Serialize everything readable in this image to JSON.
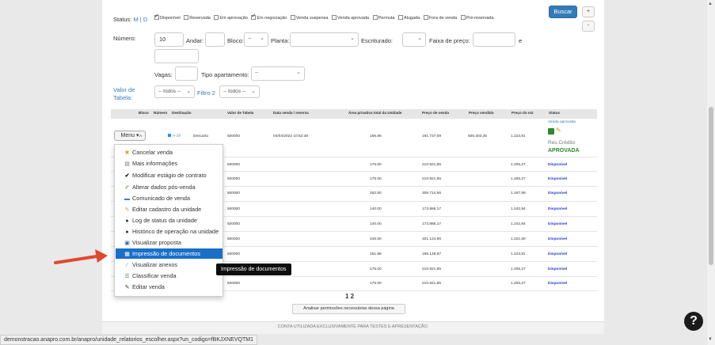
{
  "filters": {
    "status_label": "Status:",
    "status_m": "M",
    "status_sep": "|",
    "status_d": "D",
    "checkboxes": [
      {
        "label": "Disponível",
        "checked": true
      },
      {
        "label": "Reservada",
        "checked": false
      },
      {
        "label": "Em aprovação",
        "checked": false
      },
      {
        "label": "Em negociação",
        "checked": true
      },
      {
        "label": "Venda suspensa",
        "checked": false
      },
      {
        "label": "Venda aprovada",
        "checked": false
      },
      {
        "label": "Permuta",
        "checked": false
      },
      {
        "label": "Alugada",
        "checked": false
      },
      {
        "label": "Fora de venda",
        "checked": false
      },
      {
        "label": "Pré-reservada",
        "checked": false
      }
    ],
    "numero_label": "Número:",
    "numero_value": "10",
    "andar_label": "Andar:",
    "bloco_label": "Bloco:",
    "bloco_value": "--",
    "planta_label": "Planta:",
    "escriturado_label": "Escriturado:",
    "faixa_label": "Faixa de preço:",
    "e_label": "e",
    "vagas_label": "Vagas:",
    "tipo_label": "Tipo apartamento:",
    "tipo_value": "--",
    "valor_tabela_label": "Valor de Tabela:",
    "todos_1": "-- todos --",
    "filtro2_label": "Filtro 2",
    "todos_2": "-- todos --",
    "buscar_label": "Buscar",
    "plus_label": "+",
    "minus_label": "-"
  },
  "table": {
    "headers": [
      "Bloco",
      "Número",
      "Destinação",
      "Valor de Tabela",
      "Data venda / reserva",
      "Área privativa total da Unidade",
      "Preço de venda",
      "Preço vendido",
      "Preço do m2",
      "Status"
    ],
    "first_row": {
      "menu_label": "Menu ▾",
      "bloco": "A",
      "numero": "A-10",
      "destinacao": "Descarto",
      "valor": "500000",
      "data": "04/04/2022 10:52:38",
      "area": "156.88",
      "preco_venda": "191.737,09",
      "preco_vendido": "505.303,35",
      "preco_m2": "1.223,81",
      "status_top": "Venda aprovada",
      "res_credito": "Res.Crédito",
      "aprovada": "APROVADA"
    },
    "rows": [
      {
        "valor": "500000",
        "area": "175.00",
        "preco": "210.921,85",
        "m2": "1.205,27",
        "status": "Disponível"
      },
      {
        "valor": "500000",
        "area": "175.00",
        "preco": "210.921,85",
        "m2": "1.205,27",
        "status": "Disponível"
      },
      {
        "valor": "500000",
        "area": "262.50",
        "preco": "306.714,56",
        "m2": "1.167,99",
        "status": "Disponível"
      },
      {
        "valor": "500000",
        "area": "140.00",
        "preco": "173.866,17",
        "m2": "1.242,84",
        "status": "Disponível"
      },
      {
        "valor": "500000",
        "area": "140.00",
        "preco": "173.866,17",
        "m2": "1.242,84",
        "status": "Disponível"
      },
      {
        "valor": "500000",
        "area": "246.50",
        "preco": "301.124,96",
        "m2": "1.221,60",
        "status": "Disponível"
      },
      {
        "valor": "500000",
        "area": "161.88",
        "preco": "198.128,97",
        "m2": "1.223,81",
        "status": "Disponível"
      },
      {
        "valor": "500000",
        "area": "175.00",
        "preco": "210.921,85",
        "m2": "1.205,27",
        "status": "Disponível"
      },
      {
        "valor": "500000",
        "area": "175.00",
        "preco": "210.921,85",
        "m2": "1.205,27",
        "status": "Disponível"
      }
    ],
    "pager": "1 2",
    "permissions_button": "Analisar permissões necessárias dessa página"
  },
  "menu": {
    "items": [
      {
        "label": "Cancelar venda",
        "icon": "cancel-icon"
      },
      {
        "label": "Mais informações",
        "icon": "info-icon"
      },
      {
        "label": "Modificar estágio de contrato",
        "icon": "check-icon"
      },
      {
        "label": "Alterar dados pós-venda",
        "icon": "edit-check-icon"
      },
      {
        "label": "Comunicado de venda",
        "icon": "announcement-icon"
      },
      {
        "label": "Editar cadastro da unidade",
        "icon": "pencil-icon"
      },
      {
        "label": "Log de status da unidade",
        "icon": "log-icon"
      },
      {
        "label": "Histórico de operação na unidade",
        "icon": "history-icon"
      },
      {
        "label": "Visualizar proposta",
        "icon": "proposal-icon"
      },
      {
        "label": "Impressão de documentos",
        "icon": "print-icon",
        "active": true
      },
      {
        "label": "Visualizar anexos",
        "icon": "attachment-icon"
      },
      {
        "label": "Classificar venda",
        "icon": "classify-icon"
      },
      {
        "label": "Editar venda",
        "icon": "edit-icon"
      }
    ],
    "tooltip": "Impressão de documentos"
  },
  "footer": {
    "notice": "CONTA UTILIZADA EXCLUSIVAMENTE PARA TESTES E APRESENTAÇÃO.",
    "status_url": "demonstracao.anapro.com.br/anapro/unidade_relatorios_escolher.aspx?un_codigo=fBKJXNEVQTM1"
  },
  "help": {
    "label": "?"
  },
  "colors": {
    "accent": "#337ab7",
    "menu_active": "#1a6fc9",
    "available": "#2a39d3",
    "approved": "#2d8a2d"
  }
}
